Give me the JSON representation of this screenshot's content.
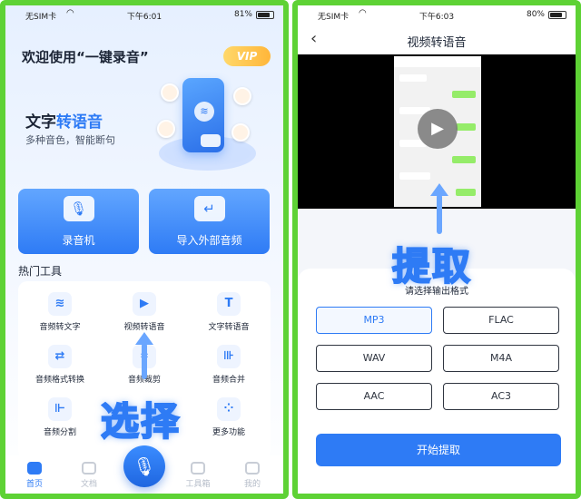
{
  "left_phone": {
    "status": {
      "carrier": "无SIM卡",
      "time": "下午6:01",
      "battery": "81%",
      "battery_level": 0.81
    },
    "welcome": "欢迎使用“一键录音”",
    "vip_badge": "VIP",
    "banner": {
      "title_prefix": "文字",
      "title_highlight": "转语音",
      "subtitle": "多种音色，智能断句"
    },
    "big_buttons": [
      {
        "label": "录音机",
        "icon": "mic-icon"
      },
      {
        "label": "导入外部音频",
        "icon": "import-icon"
      }
    ],
    "section_title": "热门工具",
    "tools": [
      {
        "label": "音频转文字",
        "icon": "audio-to-text-icon",
        "glyph": "≋"
      },
      {
        "label": "视频转语音",
        "icon": "video-to-audio-icon",
        "glyph": "▶"
      },
      {
        "label": "文字转语音",
        "icon": "text-to-speech-icon",
        "glyph": "T"
      },
      {
        "label": "音频格式转换",
        "icon": "format-convert-icon",
        "glyph": "⇄"
      },
      {
        "label": "音频裁剪",
        "icon": "crop-icon",
        "glyph": "⌗"
      },
      {
        "label": "音频合并",
        "icon": "merge-icon",
        "glyph": "⊪"
      },
      {
        "label": "音频分割",
        "icon": "split-icon",
        "glyph": "⊩"
      },
      {
        "label": "更多功能",
        "icon": "more-icon",
        "glyph": "⁘"
      }
    ],
    "caption": "选择",
    "tabbar": [
      {
        "label": "首页",
        "active": true
      },
      {
        "label": "文档",
        "active": false
      },
      {
        "label": "工具箱",
        "active": false
      },
      {
        "label": "我的",
        "active": false
      }
    ]
  },
  "right_phone": {
    "status": {
      "carrier": "无SIM卡",
      "time": "下午6:03",
      "battery": "80%",
      "battery_level": 0.8
    },
    "nav_title": "视频转语音",
    "back_icon": "chevron-left-icon",
    "caption": "提取",
    "prompt": "请选择输出格式",
    "formats": [
      {
        "label": "MP3",
        "selected": true
      },
      {
        "label": "FLAC",
        "selected": false
      },
      {
        "label": "WAV",
        "selected": false
      },
      {
        "label": "M4A",
        "selected": false
      },
      {
        "label": "AAC",
        "selected": false
      },
      {
        "label": "AC3",
        "selected": false
      }
    ],
    "start_button": "开始提取"
  },
  "colors": {
    "accent": "#2e7bf5",
    "frame": "#5ed235",
    "vip": "#ffc34a"
  }
}
